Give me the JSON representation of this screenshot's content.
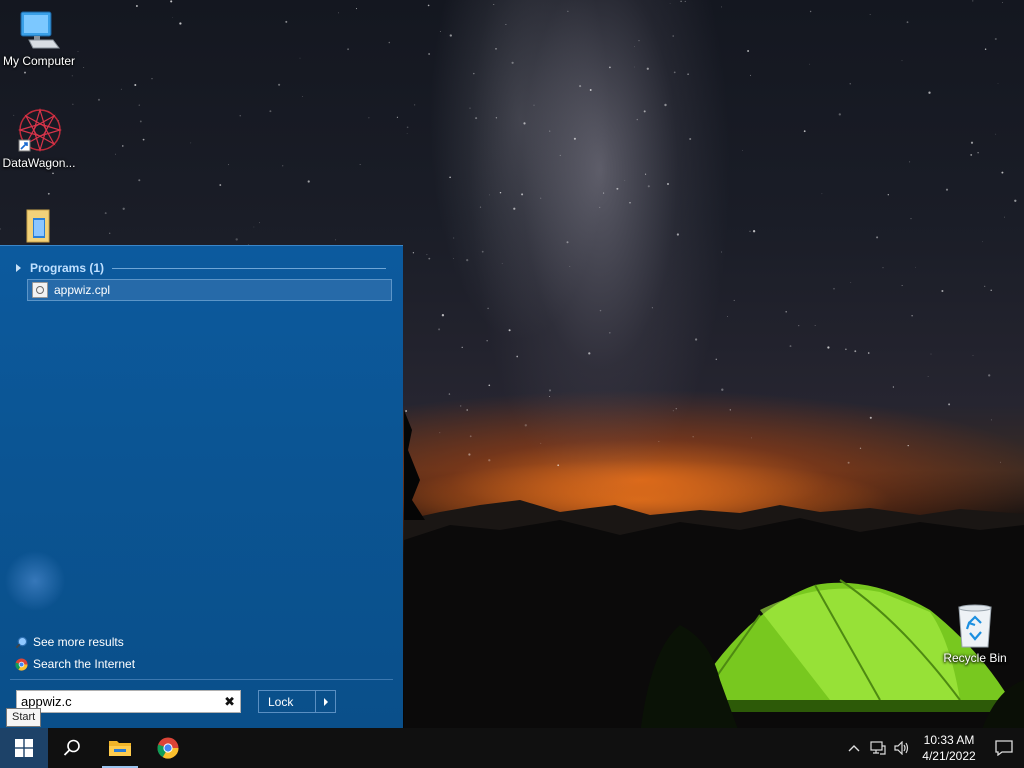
{
  "desktop": {
    "icons": [
      {
        "label": "My Computer"
      },
      {
        "label": "DataWagon..."
      },
      {
        "label": ""
      },
      {
        "label": "Recycle Bin"
      }
    ]
  },
  "start_menu": {
    "programs_header": "Programs (1)",
    "results": [
      {
        "label": "appwiz.cpl",
        "icon": "control-panel-file-icon"
      }
    ],
    "see_more": "See more results",
    "search_internet": "Search the Internet",
    "search": {
      "value": "appwiz.c"
    },
    "clear_glyph": "✖",
    "lock_label": "Lock",
    "tooltip": "Start"
  },
  "taskbar": {
    "buttons": [
      "windows-start-icon",
      "search-icon",
      "file-explorer-icon",
      "chrome-icon"
    ],
    "tray": {
      "time": "10:33 AM",
      "date": "4/21/2022",
      "chevron": "^"
    }
  },
  "colors": {
    "start_menu_bg": "#0b5594",
    "taskbar_bg": "#101010",
    "tent_green": "#8ee02a"
  }
}
